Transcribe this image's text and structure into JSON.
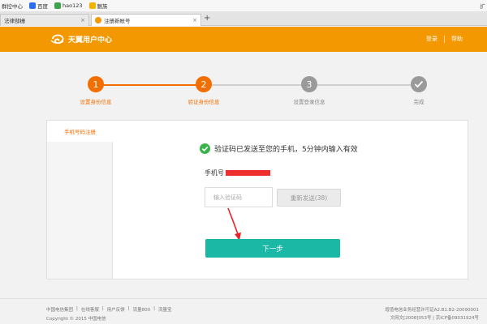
{
  "browser": {
    "bookmarks": [
      {
        "label": "群控中心",
        "color": "#2a7ed8"
      },
      {
        "label": "百度",
        "color": "#2d6df0"
      },
      {
        "label": "hao123",
        "color": "#3fa34d"
      },
      {
        "label": "魅族",
        "color": "#f2b400"
      }
    ],
    "bookmarks_right": "扩",
    "tabs": [
      {
        "label": "法律部栅"
      },
      {
        "label": "注册新帐号"
      }
    ],
    "new_tab": "+",
    "close": "×"
  },
  "header": {
    "logo_text": "天翼用户中心",
    "login": "登录",
    "help": "帮助",
    "brand_color": "#f39800"
  },
  "steps": [
    {
      "number": "1",
      "label": "设置身份信息",
      "state": "done"
    },
    {
      "number": "2",
      "label": "验证身份信息",
      "state": "current"
    },
    {
      "number": "3",
      "label": "设置登录信息",
      "state": "todo"
    },
    {
      "number": "",
      "label": "完成",
      "state": "todo"
    }
  ],
  "panel": {
    "side_tab": "手机号码注册",
    "notice": "验证码已发送至您的手机，5分钟内输入有效",
    "phone_label": "手机号",
    "code_placeholder": "输入验证码",
    "resend_label": "重新发送(38)",
    "next_label": "下一步",
    "accent_color": "#1cb8a6"
  },
  "footer": {
    "links": [
      "中国电信集团",
      "|",
      "在线客服",
      "|",
      "用户反馈",
      "|",
      "流量800",
      "|",
      "流量宝"
    ],
    "copyright": "Copyright © 2015 中国电信",
    "right_line1": "增值电信业务经营许可证A2.B1.B2-20090001",
    "right_line2": "文网文[2008]053号 | 京ICP备09031924号"
  }
}
